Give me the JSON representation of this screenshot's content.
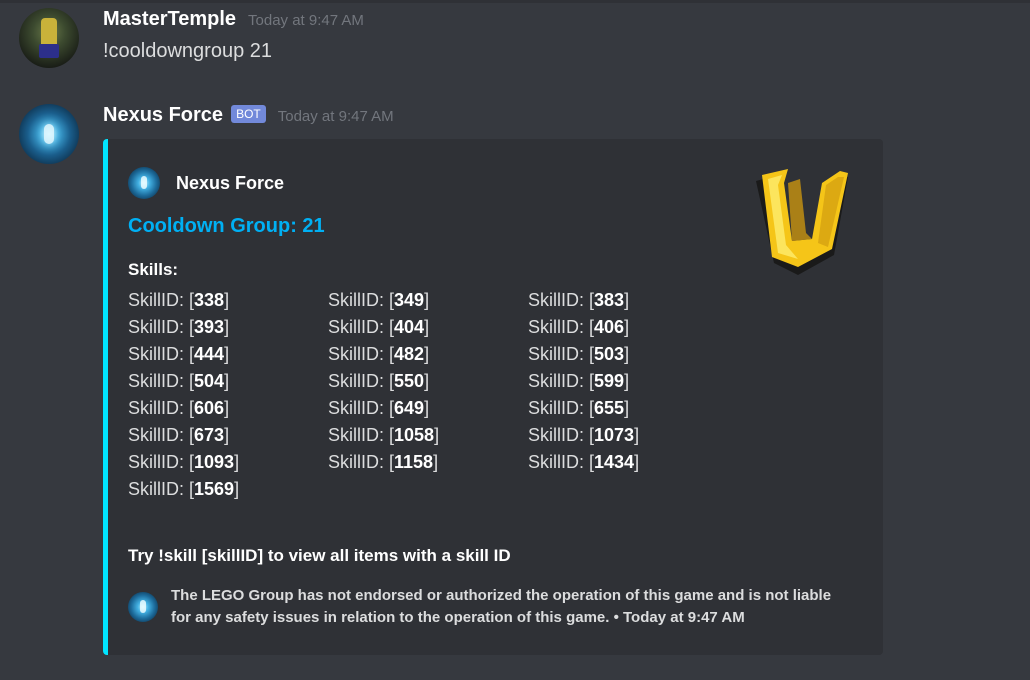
{
  "messages": [
    {
      "author": "MasterTemple",
      "timestamp": "Today at 9:47 AM",
      "content": "!cooldowngroup 21"
    },
    {
      "author": "Nexus Force",
      "bot_tag": "BOT",
      "timestamp": "Today at 9:47 AM",
      "embed": {
        "accent_color": "#00e5ff",
        "author_name": "Nexus Force",
        "title": "Cooldown Group: 21",
        "field_name": "Skills:",
        "skill_prefix": "SkillID: [",
        "skill_suffix": "]",
        "skills": [
          "338",
          "349",
          "383",
          "393",
          "404",
          "406",
          "444",
          "482",
          "503",
          "504",
          "550",
          "599",
          "606",
          "649",
          "655",
          "673",
          "1058",
          "1073",
          "1093",
          "1158",
          "1434",
          "1569"
        ],
        "description": "Try !skill [skillID] to view all items with a skill ID",
        "footer_text": "The LEGO Group has not endorsed or authorized the operation of this game and is not liable for any safety issues in relation to the operation of this game. • Today at 9:47 AM",
        "thumbnail": "u-logo"
      }
    }
  ]
}
